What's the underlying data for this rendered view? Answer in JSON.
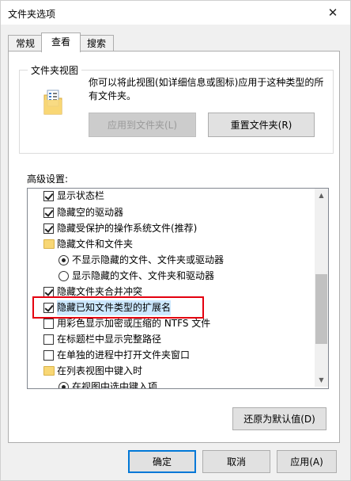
{
  "window": {
    "title": "文件夹选项",
    "close_glyph": "✕"
  },
  "tabs": [
    {
      "label": "常规",
      "active": false
    },
    {
      "label": "查看",
      "active": true
    },
    {
      "label": "搜索",
      "active": false
    }
  ],
  "folder_views": {
    "group_label": "文件夹视图",
    "description": "你可以将此视图(如详细信息或图标)应用于这种类型的所有文件夹。",
    "apply_button": "应用到文件夹(L)",
    "reset_button": "重置文件夹(R)"
  },
  "advanced": {
    "label": "高级设置:",
    "items": [
      {
        "type": "checkbox",
        "checked": true,
        "label": "显示状态栏"
      },
      {
        "type": "checkbox",
        "checked": true,
        "label": "隐藏空的驱动器"
      },
      {
        "type": "checkbox",
        "checked": true,
        "label": "隐藏受保护的操作系统文件(推荐)"
      },
      {
        "type": "folder",
        "label": "隐藏文件和文件夹"
      },
      {
        "type": "radio",
        "checked": true,
        "label": "不显示隐藏的文件、文件夹或驱动器"
      },
      {
        "type": "radio",
        "checked": false,
        "label": "显示隐藏的文件、文件夹和驱动器"
      },
      {
        "type": "checkbox",
        "checked": true,
        "label": "隐藏文件夹合并冲突"
      },
      {
        "type": "checkbox",
        "checked": true,
        "label": "隐藏已知文件类型的扩展名",
        "selected": true
      },
      {
        "type": "checkbox",
        "checked": false,
        "label": "用彩色显示加密或压缩的 NTFS 文件"
      },
      {
        "type": "checkbox",
        "checked": false,
        "label": "在标题栏中显示完整路径"
      },
      {
        "type": "checkbox",
        "checked": false,
        "label": "在单独的进程中打开文件夹窗口"
      },
      {
        "type": "folder",
        "label": "在列表视图中键入时"
      },
      {
        "type": "radio",
        "checked": true,
        "label": "在视图中选中键入项"
      }
    ],
    "scroll_up_glyph": "▲",
    "scroll_down_glyph": "▼",
    "restore_button": "还原为默认值(D)"
  },
  "footer": {
    "ok": "确定",
    "cancel": "取消",
    "apply": "应用(A)"
  },
  "colors": {
    "selection": "#cce8ff",
    "annotation_red": "#e4000f",
    "default_button_border": "#0078d7"
  }
}
